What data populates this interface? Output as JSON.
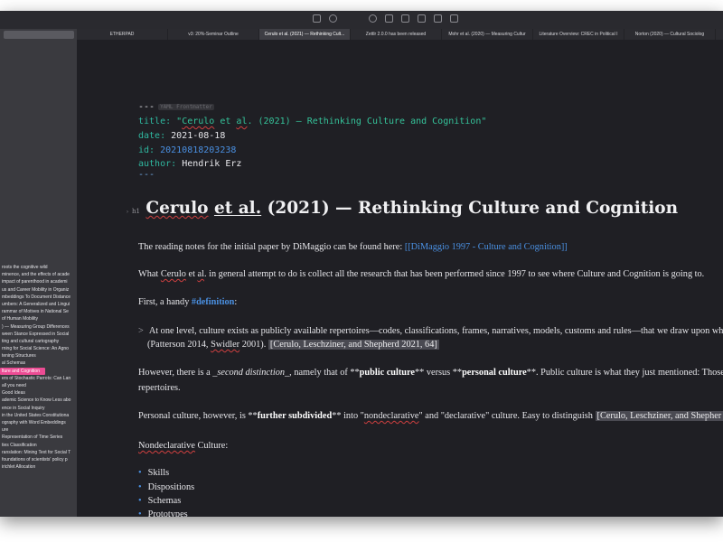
{
  "tabs": [
    "ETHERPAD",
    "v3: 20%-Seminar Outline",
    "Cerulo et al. (2021) — Rethinking Cult...",
    "Zettlr 2.0.0 has been released",
    "Mohr et al. (2020) — Measuring Cultur",
    "Literature Overview: CREC in Political I",
    "Norton (2020) — Cultural Sociolog"
  ],
  "sidebar": {
    "files": [
      "roots the cognitive wild",
      "minence, and the effects of acade",
      "impact of parenthood in academi",
      "us and Career Mobility in Organiz",
      "mbeddings To Document Distance",
      "umbers: A Generalized and Lingui",
      "rammar of Motives in National Se",
      "of Human Mobility",
      ") — Measuring Group Differences",
      "ween Stance Expressed in Social",
      "ting and cultural cartography",
      "rning for Social Science: An Agno",
      "tening Structures",
      "al Schemas",
      "lture and Cognition",
      "ers of Stochastic Parrots: Can Lan",
      "all you need",
      "Good Ideas",
      "ademic Science to Know Less abo",
      "ence in Social Inquiry",
      "in the United States Constitutiona",
      "ography with Word Embeddings",
      "ure",
      "Representation of Time Series",
      "ties Classification",
      "ranslation: Mining Text for Social T",
      "foundations of scientists' policy p",
      "irichlet Allocation"
    ]
  },
  "frontmatter": {
    "dashes": "---",
    "hint": "YAML Frontmatter",
    "title_key": "title:",
    "title_q1": "\"",
    "title_word1": "Cerulo",
    "title_word2": "et",
    "title_word3": "al",
    "title_rest": ". (2021) — Rethinking Culture and Cognition\"",
    "date_key": "date:",
    "date_val": "2021-08-18",
    "id_key": "id:",
    "id_val": "20210818203238",
    "author_key": "author:",
    "author_val": "Hendrik Erz",
    "end_dashes": "---"
  },
  "heading": {
    "marker": "h1",
    "word1": "Cerulo",
    "word2": "et al.",
    "rest": "(2021) — Rethinking Culture and Cognition"
  },
  "body": {
    "p1_text": "The reading notes for the initial paper by DiMaggio can be found here:",
    "p1_link": "[[DiMaggio 1997 - Culture and Cognition]]",
    "p2_pre": "What",
    "p2_w1": "Cerulo",
    "p2_w2": "et",
    "p2_w3": "al",
    "p2_rest": ". in general attempt to do is collect all the research that has been performed since 1997 to see where Culture and Cognition is going to.",
    "p3_text": "First, a handy",
    "p3_tag": "#definition",
    "p3_colon": ":",
    "bq_marker": ">",
    "bq_line1": "At one level, culture exists as publicly available repertoires—codes, classifications, frames, narratives, models, customs and rules—that we draw upon whe",
    "bq_line2_pre": "(Patterson 2014,",
    "bq_line2_w": "Swidler",
    "bq_line2_mid": "2001).",
    "bq_cite": "[Cerulo, Leschziner, and Shepherd 2021, 64]",
    "p4_pre": "However, there is a",
    "p4_ital": "_second distinction_",
    "p4_mid1": ", namely that of **",
    "p4_bold1": "public culture",
    "p4_mid2": "** versus **",
    "p4_bold2": "personal culture",
    "p4_rest": "**. Public culture is what they just mentioned: Those",
    "p4_line2": "repertoires.",
    "p5_pre": "Personal culture, however, is **",
    "p5_bold": "further subdivided",
    "p5_mid": "** into \"",
    "p5_w": "nondeclarative",
    "p5_rest": "\" and \"declarative\" culture. Easy to distinguish",
    "p5_cite": "[Cerulo, Leschziner, and Shepher",
    "p6_text": "Nondeclarative",
    "p6_rest": " Culture:",
    "list": [
      "Skills",
      "Dispositions",
      "Schemas",
      "Prototypes"
    ]
  }
}
